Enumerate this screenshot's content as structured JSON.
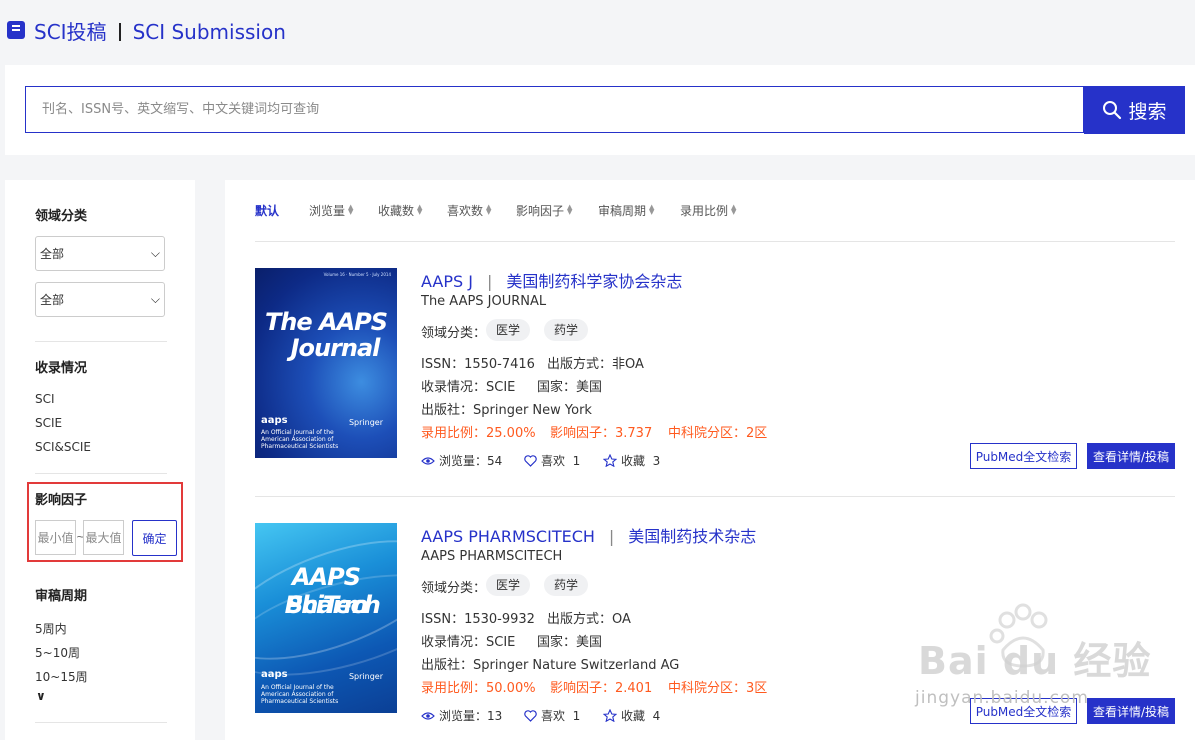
{
  "header": {
    "title_cn": "SCI投稿",
    "title_en": "SCI Submission",
    "logo_icon": "book-icon"
  },
  "search": {
    "placeholder": "刊名、ISSN号、英文缩写、中文关键词均可查询",
    "value": "",
    "button_label": "搜索",
    "icon": "search-icon"
  },
  "sidebar": {
    "field_heading": "领域分类",
    "field_select_1": "全部",
    "field_select_2": "全部",
    "index_heading": "收录情况",
    "index_items": [
      "SCI",
      "SCIE",
      "SCI&SCIE"
    ],
    "if_heading": "影响因子",
    "if_min_placeholder": "最小值",
    "if_max_placeholder": "最大值",
    "if_tilde": "~",
    "if_confirm": "确定",
    "review_heading": "审稿周期",
    "review_items": [
      "5周内",
      "5~10周",
      "10~15周"
    ],
    "more_icon": "chevron-down-icon"
  },
  "sort_bar": {
    "items": [
      "默认",
      "浏览量",
      "收藏数",
      "喜欢数",
      "影响因子",
      "审稿周期",
      "录用比例"
    ],
    "active": "默认"
  },
  "journals": [
    {
      "abbr": "AAPS J",
      "name_cn": "美国制药科学家协会杂志",
      "full_name": "The AAPS JOURNAL",
      "field_label": "领域分类：",
      "tags": [
        "医学",
        "药学"
      ],
      "issn": "ISSN：1550-7416",
      "pub_mode": "出版方式：非OA",
      "index": "收录情况：SCIE",
      "country": "国家：美国",
      "publisher": "出版社：Springer New York",
      "accept_rate": "录用比例：25.00%",
      "impact_factor": "影响因子：3.737",
      "cas_zone": "中科院分区：2区",
      "views": "浏览量：54",
      "likes": "喜欢  1",
      "favorites": "收藏  3",
      "cover": {
        "line1": "The AAPS",
        "line2": "Journal",
        "brand": "aaps",
        "springer": "Springer",
        "issue": "Volume 16 · Number 5 · July 2014",
        "foot": "An Official Journal of the American Association of Pharmaceutical Scientists"
      },
      "pubmed_btn": "PubMed全文检索",
      "detail_btn": "查看详情/投稿"
    },
    {
      "abbr": "AAPS PHARMSCITECH",
      "name_cn": "美国制药技术杂志",
      "full_name": "AAPS PHARMSCITECH",
      "field_label": "领域分类：",
      "tags": [
        "医学",
        "药学"
      ],
      "issn": "ISSN：1530-9932",
      "pub_mode": "出版方式：OA",
      "index": "收录情况：SCIE",
      "country": "国家：美国",
      "publisher": "出版社：Springer Nature Switzerland AG",
      "accept_rate": "录用比例：50.00%",
      "impact_factor": "影响因子：2.401",
      "cas_zone": "中科院分区：3区",
      "views": "浏览量：13",
      "likes": "喜欢  1",
      "favorites": "收藏  4",
      "cover": {
        "line1": "AAPS Pharm",
        "line2": "SciTech",
        "brand": "aaps",
        "springer": "Springer",
        "foot": "An Official Journal of the American Association of Pharmaceutical Scientists"
      },
      "pubmed_btn": "PubMed全文检索",
      "detail_btn": "查看详情/投稿"
    }
  ],
  "watermark": {
    "logo": "Bai du 经验",
    "url": "jingyan.baidu.com"
  },
  "colors": {
    "accent": "#2632c9",
    "highlight": "#ff5a1f",
    "outline": "#e23a3a"
  }
}
